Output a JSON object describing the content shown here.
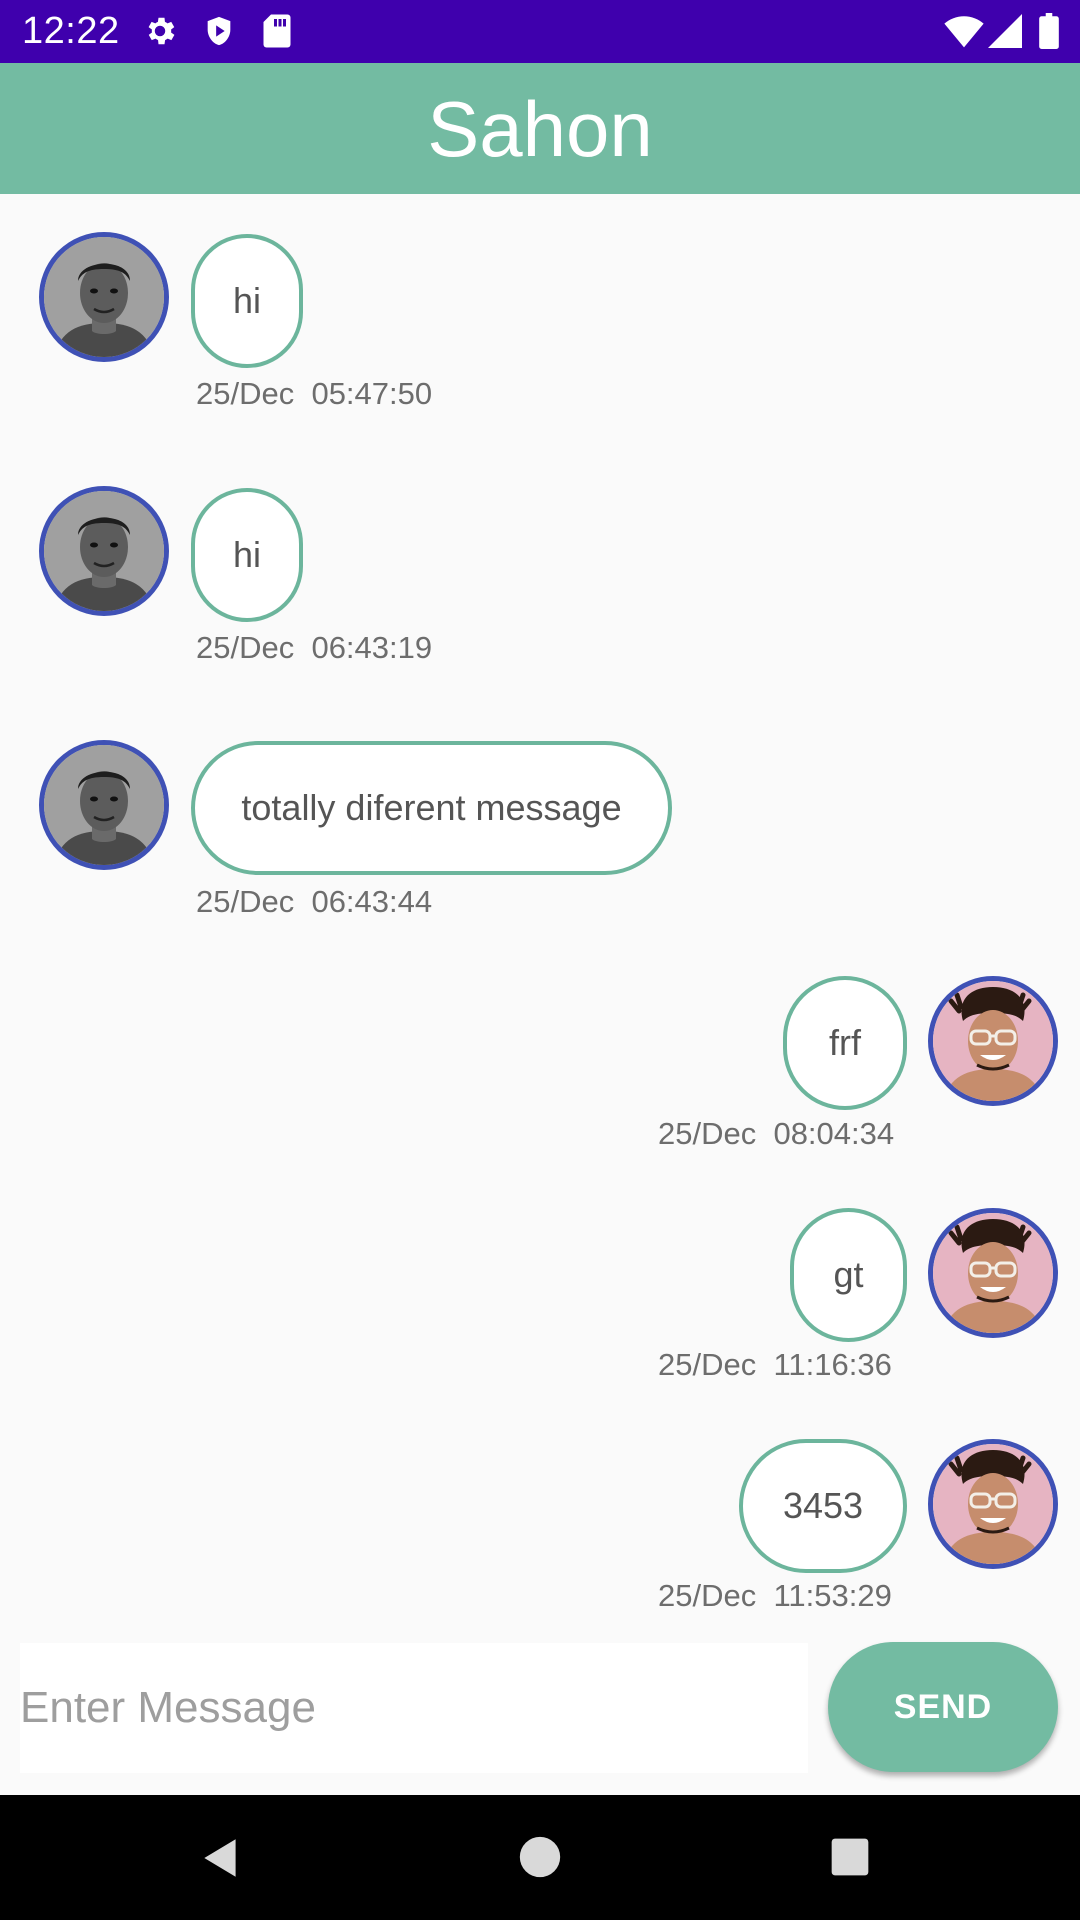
{
  "status_bar": {
    "time": "12:22",
    "icons": [
      "gear-icon",
      "shield-play-icon",
      "sd-card-icon",
      "wifi-icon",
      "cell-signal-icon",
      "battery-icon"
    ]
  },
  "app_bar": {
    "title": "Sahon"
  },
  "messages": [
    {
      "text": "hi",
      "timestamp": "25/Dec  05:47:50",
      "side": "left",
      "avatar": "avatar-man-grayscale"
    },
    {
      "text": "hi",
      "timestamp": "25/Dec  06:43:19",
      "side": "left",
      "avatar": "avatar-man-grayscale"
    },
    {
      "text": "totally diferent message",
      "timestamp": "25/Dec  06:43:44",
      "side": "left",
      "avatar": "avatar-man-grayscale"
    },
    {
      "text": "frf",
      "timestamp": "25/Dec  08:04:34",
      "side": "right",
      "avatar": "avatar-man-glasses"
    },
    {
      "text": "gt",
      "timestamp": "25/Dec  11:16:36",
      "side": "right",
      "avatar": "avatar-man-glasses"
    },
    {
      "text": "3453",
      "timestamp": "25/Dec  11:53:29",
      "side": "right",
      "avatar": "avatar-man-glasses"
    }
  ],
  "composer": {
    "placeholder": "Enter Message",
    "value": "",
    "send_label": "SEND"
  },
  "nav_bar": {
    "buttons": [
      "back-icon",
      "home-icon",
      "recents-icon"
    ]
  },
  "colors": {
    "status_bar": "#3f00ad",
    "app_bar": "#73bba2",
    "bubble_border": "#6cb59c",
    "avatar_border": "#3f51b5",
    "send_button": "#73bba2"
  }
}
